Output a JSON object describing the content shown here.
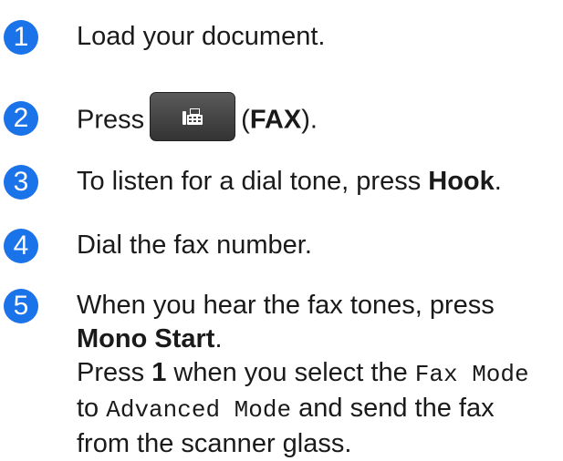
{
  "steps": [
    {
      "num": "1",
      "text": "Load your document."
    },
    {
      "num": "2",
      "pre": "Press",
      "button_label": "FAX",
      "open": "(",
      "close": ")."
    },
    {
      "num": "3",
      "pre": "To listen for a dial tone, press ",
      "bold": "Hook",
      "post": "."
    },
    {
      "num": "4",
      "text": "Dial the fax number."
    },
    {
      "num": "5",
      "line1": "When you hear the fax tones, press",
      "line2_bold": "Mono Start",
      "line2_post": ".",
      "line3_pre": "Press ",
      "line3_bold": "1",
      "line3_mid": " when you select the ",
      "line3_mono": "Fax Mode",
      "line4_pre": "to ",
      "line4_mono": "Advanced Mode",
      "line4_post": " and send the fax",
      "line5": "from the scanner glass."
    }
  ],
  "colors": {
    "badge": "#1a73e8",
    "text": "#1a1a1a",
    "button": "#444444"
  },
  "icons": {
    "fax_button": "fax-icon"
  }
}
